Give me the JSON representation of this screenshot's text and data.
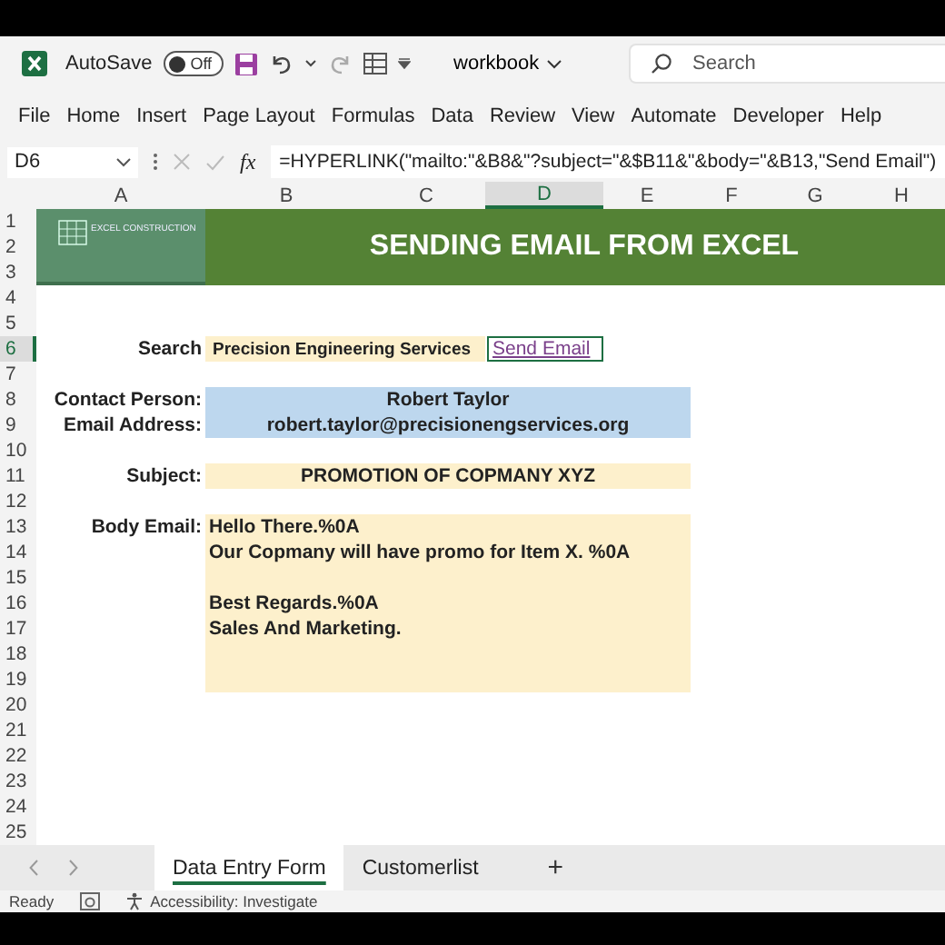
{
  "titlebar": {
    "autosave": {
      "label": "AutoSave",
      "on": false,
      "state_text": "Off"
    },
    "workbook": "workbook",
    "search": {
      "placeholder": "Search"
    }
  },
  "menu": [
    {
      "label": "File",
      "selected": false
    },
    {
      "label": "Home",
      "selected": false
    },
    {
      "label": "Insert",
      "selected": false
    },
    {
      "label": "Page Layout",
      "selected": false
    },
    {
      "label": "Formulas",
      "selected": false
    },
    {
      "label": "Data",
      "selected": false
    },
    {
      "label": "Review",
      "selected": false
    },
    {
      "label": "View",
      "selected": false
    },
    {
      "label": "Automate",
      "selected": false
    },
    {
      "label": "Developer",
      "selected": false
    },
    {
      "label": "Help",
      "selected": false
    }
  ],
  "formula_bar": {
    "name_box": "D6",
    "fx": "fx",
    "formula": "=HYPERLINK(\"mailto:\"&B8&\"?subject=\"&$B11&\"&body=\"&B13,\"Send Email\")"
  },
  "columns": [
    {
      "label": "A",
      "selected": false
    },
    {
      "label": "B",
      "selected": false
    },
    {
      "label": "C",
      "selected": false
    },
    {
      "label": "D",
      "selected": true
    },
    {
      "label": "E",
      "selected": false
    },
    {
      "label": "F",
      "selected": false
    },
    {
      "label": "G",
      "selected": false
    },
    {
      "label": "H",
      "selected": false
    }
  ],
  "rows": [
    {
      "label": "1",
      "selected": false
    },
    {
      "label": "2",
      "selected": false
    },
    {
      "label": "3",
      "selected": false
    },
    {
      "label": "4",
      "selected": false
    },
    {
      "label": "5",
      "selected": false
    },
    {
      "label": "6",
      "selected": true
    },
    {
      "label": "7",
      "selected": false
    },
    {
      "label": "8",
      "selected": false
    },
    {
      "label": "9",
      "selected": false
    },
    {
      "label": "10",
      "selected": false
    },
    {
      "label": "11",
      "selected": false
    },
    {
      "label": "12",
      "selected": false
    },
    {
      "label": "13",
      "selected": false
    },
    {
      "label": "14",
      "selected": false
    },
    {
      "label": "15",
      "selected": false
    },
    {
      "label": "16",
      "selected": false
    },
    {
      "label": "17",
      "selected": false
    },
    {
      "label": "18",
      "selected": false
    },
    {
      "label": "19",
      "selected": false
    },
    {
      "label": "20",
      "selected": false
    },
    {
      "label": "21",
      "selected": false
    },
    {
      "label": "22",
      "selected": false
    },
    {
      "label": "23",
      "selected": false
    },
    {
      "label": "24",
      "selected": false
    },
    {
      "label": "25",
      "selected": false
    }
  ],
  "sheet": {
    "logo_text": "EXCEL CONSTRUCTION",
    "title": "SENDING EMAIL FROM EXCEL",
    "search_label": "Search",
    "search_value": "Precision Engineering Services",
    "link": "Send Email",
    "contact_label": "Contact Person:",
    "contact_value": "Robert Taylor",
    "email_label": "Email Address:",
    "email_value": "robert.taylor@precisionengservices.org",
    "subject_label": "Subject:",
    "subject_value": "PROMOTION OF COPMANY XYZ",
    "body_label": "Body Email:",
    "body_paragraphs": [
      [
        "Hello There.%0A",
        "Our Copmany will have promo for Item X. %0A"
      ],
      [
        "Best Regards.%0A",
        "Sales And Marketing."
      ]
    ]
  },
  "sheet_tabs": [
    {
      "label": "Data Entry Form",
      "selected": true
    },
    {
      "label": "Customerlist",
      "selected": false
    }
  ],
  "add_sheet": "+",
  "status_bar": {
    "ready": "Ready",
    "accessibility": "Accessibility: Investigate"
  }
}
